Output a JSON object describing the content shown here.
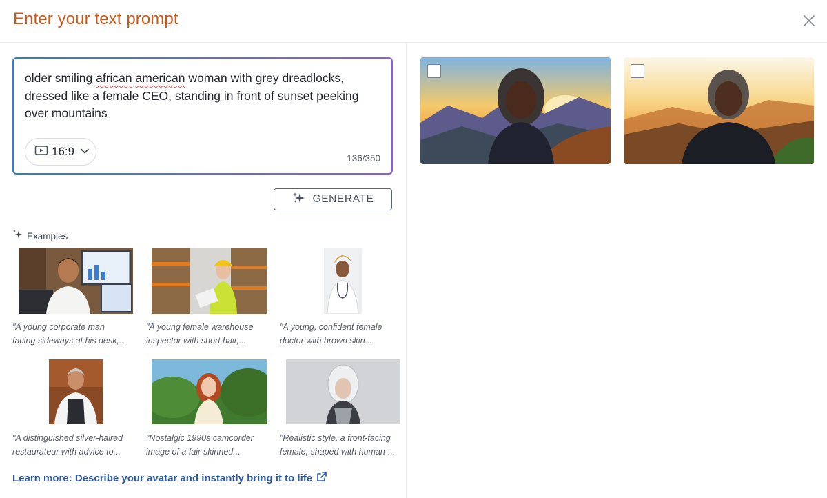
{
  "header": {
    "title": "Enter your text prompt"
  },
  "prompt": {
    "text_before": "older smiling ",
    "text_misspelled_1": "african",
    "text_space": " ",
    "text_misspelled_2": "american",
    "text_after": " woman with grey dreadlocks, dressed like a female CEO, standing in front of sunset peeking over mountains",
    "aspect_ratio": "16:9",
    "char_count": "136/350"
  },
  "generate": {
    "label": "GENERATE"
  },
  "examples": {
    "heading": "Examples",
    "items": [
      {
        "caption_1": "\"A young corporate man",
        "caption_2": "facing sideways at his desk,..."
      },
      {
        "caption_1": "\"A young female warehouse",
        "caption_2": "inspector with short hair,..."
      },
      {
        "caption_1": "\"A young, confident female",
        "caption_2": "doctor with brown skin..."
      },
      {
        "caption_1": "\"A distinguished silver-haired",
        "caption_2": "restaurateur with advice to..."
      },
      {
        "caption_1": "\"Nostalgic 1990s camcorder",
        "caption_2": "image of a fair-skinned..."
      },
      {
        "caption_1": "\"Realistic style, a front-facing",
        "caption_2": "female, shaped with human-..."
      }
    ]
  },
  "learn_more": {
    "label": "Learn more: Describe your avatar and instantly bring it to life"
  },
  "colors": {
    "title": "#c85a1e",
    "link": "#2c5aa0",
    "gradient_start": "#2f7bd8",
    "gradient_end": "#8a5be3"
  },
  "icons": {
    "close": "close-icon",
    "ratio": "video-frame-icon",
    "chevron": "chevron-down-icon",
    "sparkle": "sparkle-icon",
    "external": "external-link-icon"
  }
}
